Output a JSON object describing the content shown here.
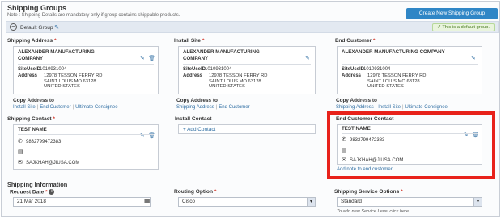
{
  "header": {
    "title": "Shipping Groups",
    "note": "Note : Shipping Details are mandatory only if group contains shippable products.",
    "create_button": "Create New Shipping Group"
  },
  "group": {
    "name": "Default Group",
    "badge": "This is a default group."
  },
  "shipping_address": {
    "label": "Shipping Address",
    "company": "ALEXANDER MANUFACTURING COMPANY",
    "siteuseid_label": "SiteUseID",
    "siteuseid": "1010931004",
    "address_label": "Address",
    "address_lines": [
      "12978 TESSON FERRY RD",
      "SAINT LOUIS MO 63128",
      "UNITED STATES"
    ],
    "copy_label": "Copy Address to",
    "copy_links": [
      "Install Site",
      "End Customer",
      "Ultimate Consignee"
    ]
  },
  "install_site": {
    "label": "Install Site",
    "company": "ALEXANDER MANUFACTURING COMPANY",
    "siteuseid_label": "SiteUseID",
    "siteuseid": "1010931004",
    "address_label": "Address",
    "address_lines": [
      "12978 TESSON FERRY RD",
      "SAINT LOUIS MO 63128",
      "UNITED STATES"
    ],
    "copy_label": "Copy Address to",
    "copy_links": [
      "Shipping Address",
      "End Customer"
    ]
  },
  "end_customer": {
    "label": "End Customer",
    "company": "ALEXANDER MANUFACTURING COMPANY",
    "siteuseid_label": "SiteUseID",
    "siteuseid": "1010931004",
    "address_label": "Address",
    "address_lines": [
      "12978 TESSON FERRY RD",
      "SAINT LOUIS MO 63128",
      "UNITED STATES"
    ],
    "copy_label": "Copy Address to",
    "copy_links": [
      "Shipping Address",
      "Install Site",
      "Ultimate Consignee"
    ]
  },
  "shipping_contact": {
    "label": "Shipping Contact",
    "name": "TEST NAME",
    "phone": "9832799472383",
    "email": "SAJKHAH@JIUSA.COM"
  },
  "install_contact": {
    "label": "Install Contact",
    "add_link": "+ Add Contact"
  },
  "end_customer_contact": {
    "label": "End Customer Contact",
    "name": "TEST NAME",
    "phone": "9832799472383",
    "email": "SAJKHAH@JIUSA.COM",
    "add_note": "Add note to end customer"
  },
  "shipping_information": {
    "title": "Shipping Information",
    "request_date_label": "Request Date",
    "request_date_value": "21 Mar 2018",
    "routing_label": "Routing Option",
    "routing_value": "Cisco",
    "service_label": "Shipping Service Options",
    "service_value": "Standard",
    "service_hint": "To add new Service Level click here."
  },
  "icons": {
    "edit": "pencil-icon",
    "delete": "trash-icon",
    "phone": "phone-icon",
    "fax": "fax-icon",
    "email": "email-icon",
    "calendar": "calendar-icon",
    "info": "info-icon",
    "check": "check-icon"
  },
  "colors": {
    "accent": "#2f86c6",
    "link": "#2f6ea3",
    "highlight": "#e8221b",
    "required": "#d43b2f"
  }
}
